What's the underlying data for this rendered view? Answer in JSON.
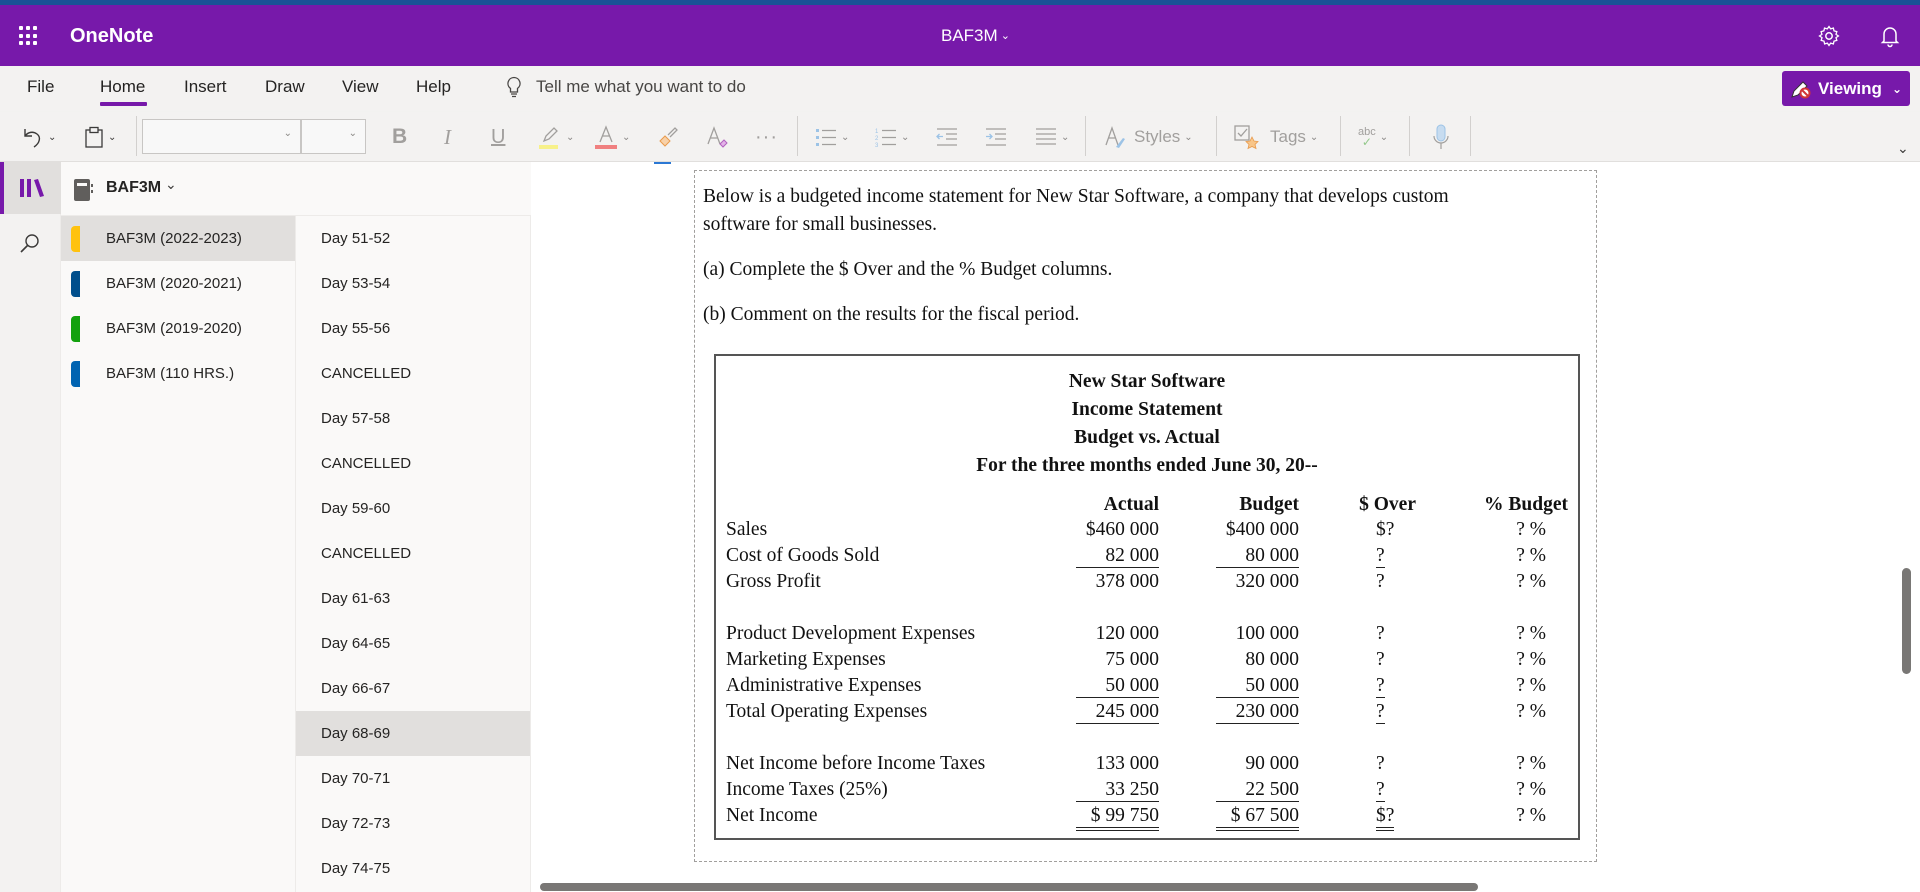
{
  "app": {
    "name": "OneNote",
    "notebook_title": "BAF3M",
    "settings_icon": "gear-icon",
    "notifications_icon": "bell-icon"
  },
  "menu": {
    "items": [
      "File",
      "Home",
      "Insert",
      "Draw",
      "View",
      "Help"
    ],
    "active": "Home",
    "tell_me_placeholder": "Tell me what you want to do",
    "viewing_label": "Viewing"
  },
  "toolbar": {
    "font_name": "",
    "font_size": "",
    "bold": "B",
    "italic": "I",
    "underline": "U",
    "styles_label": "Styles",
    "tags_label": "Tags",
    "spell_label": "abc",
    "highlight_color": "#f7f18a",
    "font_color": "#f08080"
  },
  "sidebar": {
    "notebook": "BAF3M",
    "sections": [
      {
        "label": "BAF3M (2022-2023)",
        "color": "#ffc20e",
        "selected": true
      },
      {
        "label": "BAF3M (2020-2021)",
        "color": "#004e8c",
        "selected": false
      },
      {
        "label": "BAF3M (2019-2020)",
        "color": "#13a10e",
        "selected": false
      },
      {
        "label": "BAF3M (110 HRS.)",
        "color": "#0063b1",
        "selected": false
      }
    ],
    "pages": [
      {
        "label": "Day 51-52",
        "selected": false
      },
      {
        "label": "Day 53-54",
        "selected": false
      },
      {
        "label": "Day 55-56",
        "selected": false
      },
      {
        "label": "CANCELLED",
        "selected": false
      },
      {
        "label": "Day 57-58",
        "selected": false
      },
      {
        "label": "CANCELLED",
        "selected": false
      },
      {
        "label": "Day 59-60",
        "selected": false
      },
      {
        "label": "CANCELLED",
        "selected": false
      },
      {
        "label": "Day 61-63",
        "selected": false
      },
      {
        "label": "Day 64-65",
        "selected": false
      },
      {
        "label": "Day 66-67",
        "selected": false
      },
      {
        "label": "Day 68-69",
        "selected": true
      },
      {
        "label": "Day 70-71",
        "selected": false
      },
      {
        "label": "Day 72-73",
        "selected": false
      },
      {
        "label": "Day 74-75",
        "selected": false
      }
    ]
  },
  "page": {
    "intro_line1": "Below is a budgeted income statement for New Star Software, a company that develops custom",
    "intro_line2": "software for small businesses.",
    "question_a": "(a) Complete the $ Over and the % Budget columns.",
    "question_b": "(b) Comment on the results for the fiscal period.",
    "statement": {
      "title1": "New Star Software",
      "title2": "Income Statement",
      "title3": "Budget vs. Actual",
      "title4": "For the three months ended June 30, 20--",
      "headers": [
        "Actual",
        "Budget",
        "$ Over",
        "% Budget"
      ],
      "rows": [
        {
          "label": "Sales",
          "actual": "$460 000",
          "budget": "$400 000",
          "over": "$?",
          "pct": "? %",
          "ul": ""
        },
        {
          "label": "Cost of Goods Sold",
          "actual": "82 000",
          "budget": "80 000",
          "over": "?",
          "pct": "? %",
          "ul": "single"
        },
        {
          "label": "Gross Profit",
          "actual": "378 000",
          "budget": "320 000",
          "over": "?",
          "pct": "? %",
          "ul": ""
        },
        {
          "label": "Product Development Expenses",
          "actual": "120 000",
          "budget": "100 000",
          "over": "?",
          "pct": "? %",
          "ul": ""
        },
        {
          "label": "Marketing Expenses",
          "actual": "75 000",
          "budget": "80 000",
          "over": "?",
          "pct": "? %",
          "ul": ""
        },
        {
          "label": "Administrative Expenses",
          "actual": "50 000",
          "budget": "50 000",
          "over": "?",
          "pct": "? %",
          "ul": "single"
        },
        {
          "label": "Total Operating Expenses",
          "actual": "245 000",
          "budget": "230 000",
          "over": "?",
          "pct": "? %",
          "ul": "single"
        },
        {
          "label": "Net Income before Income Taxes",
          "actual": "133 000",
          "budget": "90 000",
          "over": "?",
          "pct": "? %",
          "ul": ""
        },
        {
          "label": "Income Taxes (25%)",
          "actual": "33 250",
          "budget": "22 500",
          "over": "?",
          "pct": "? %",
          "ul": "single"
        },
        {
          "label": "Net Income",
          "actual": "$ 99 750",
          "budget": "$ 67 500",
          "over": "$?",
          "pct": "? %",
          "ul": "double"
        }
      ]
    }
  },
  "colors": {
    "brand": "#7719aa",
    "top_strip": "#1a5296"
  }
}
